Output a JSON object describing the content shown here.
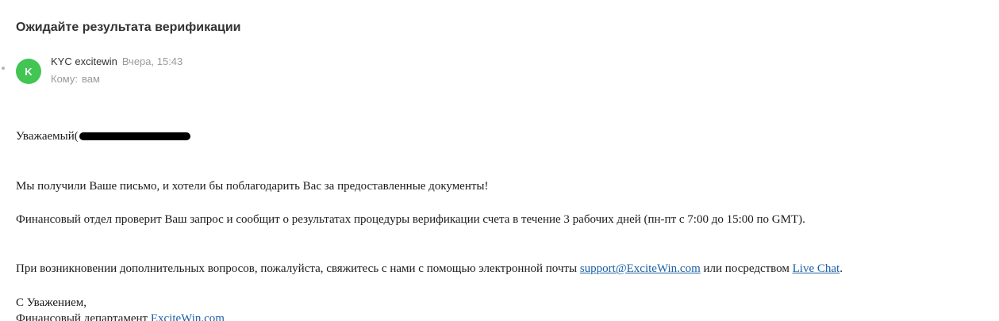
{
  "email": {
    "subject": "Ожидайте результата верификации",
    "sender": {
      "avatar_letter": "K",
      "avatar_color": "#42c553",
      "name": "KYC excitewin",
      "date": "Вчера, 15:43"
    },
    "recipient": {
      "label": "Кому:",
      "value": "вам"
    },
    "body": {
      "greeting": "Уважаемый(",
      "para1": "Мы получили Ваше письмо, и хотели бы поблагодарить Вас за предоставленные документы!",
      "para2": "Финансовый отдел проверит Ваш запрос и сообщит о результатах процедуры верификации счета в течение 3 рабочих дней (пн-пт с 7:00 до 15:00 по GMT).",
      "para3_prefix": "При возникновении дополнительных вопросов, пожалуйста, свяжитесь с нами с помощью электронной почты ",
      "support_link": "support@ExciteWin.com",
      "para3_middle": " или посредством ",
      "live_chat_link": "Live Chat",
      "para3_suffix": ".",
      "closing": "С Уважением,",
      "signature_prefix": "Финансовый департамент ",
      "signature_link": "ExciteWin.com"
    }
  },
  "colors": {
    "link": "#1a5fa6",
    "meta_gray": "#999999"
  }
}
